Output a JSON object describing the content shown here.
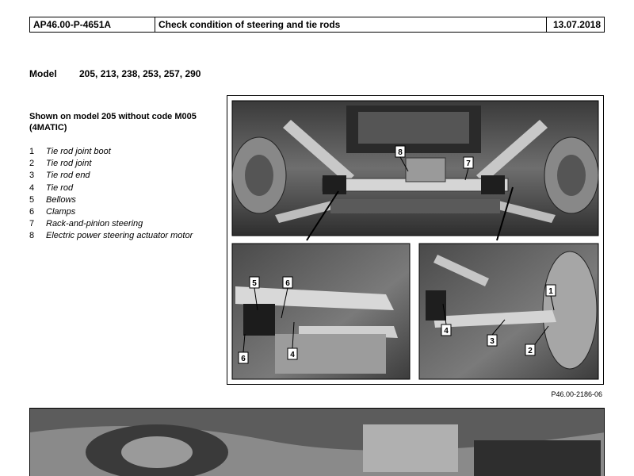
{
  "header": {
    "doc_number": "AP46.00-P-4651A",
    "title": "Check condition of steering and tie rods",
    "date": "13.07.2018"
  },
  "model": {
    "label": "Model",
    "values": "205, 213, 238, 253, 257, 290"
  },
  "figure": {
    "caption_heading": "Shown on model 205 without code M005 (4MATIC)",
    "legend": [
      {
        "num": "1",
        "text": "Tie rod joint boot"
      },
      {
        "num": "2",
        "text": "Tie rod joint"
      },
      {
        "num": "3",
        "text": "Tie rod end"
      },
      {
        "num": "4",
        "text": "Tie rod"
      },
      {
        "num": "5",
        "text": "Bellows"
      },
      {
        "num": "6",
        "text": "Clamps"
      },
      {
        "num": "7",
        "text": "Rack-and-pinion steering"
      },
      {
        "num": "8",
        "text": "Electric power steering actuator motor"
      }
    ],
    "callouts": {
      "top": [
        "8",
        "7"
      ],
      "bottom_left": [
        "5",
        "6",
        "4",
        "6"
      ],
      "bottom_right": [
        "1",
        "4",
        "3",
        "2"
      ]
    },
    "figure_code": "P46.00-2186-06"
  }
}
